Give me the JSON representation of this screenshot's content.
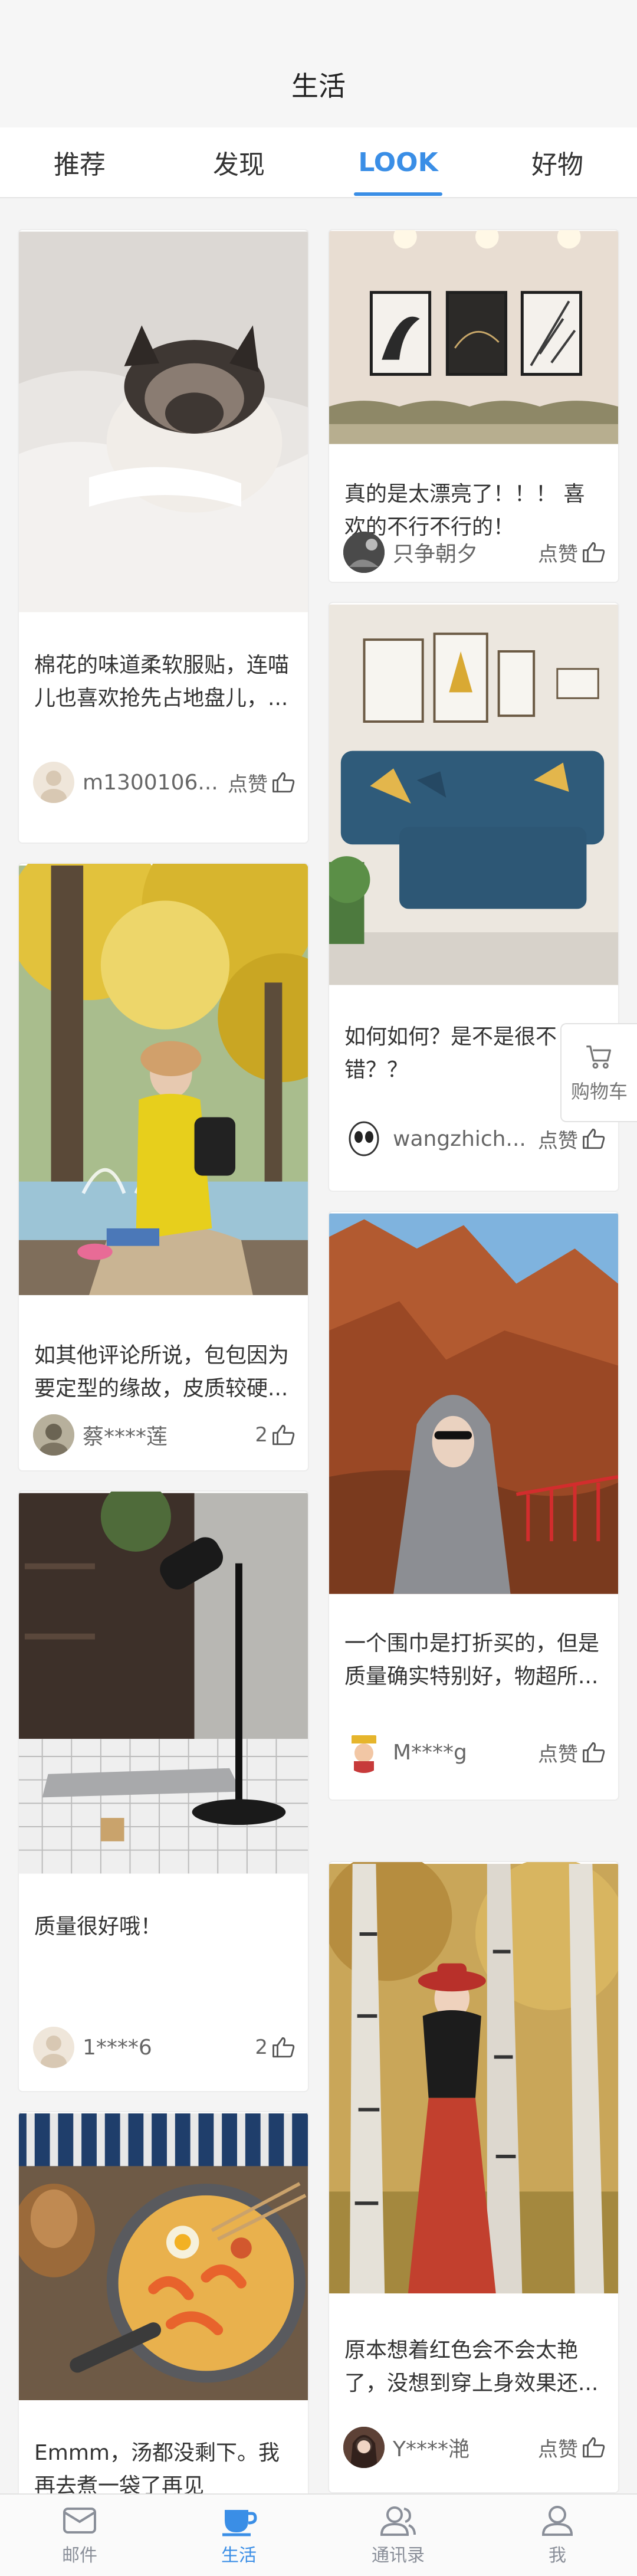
{
  "header": {
    "title": "生活"
  },
  "tabs": [
    {
      "label": "推荐",
      "active": false
    },
    {
      "label": "发现",
      "active": false
    },
    {
      "label": "LOOK",
      "active": true
    },
    {
      "label": "好物",
      "active": false
    }
  ],
  "posts": [
    {
      "column": "left",
      "photo": "cat-on-blanket",
      "text": "棉花的味道柔软服贴，连喵儿也喜欢抢先占地盘儿，...",
      "user": "m1300106...",
      "like": "点赞"
    },
    {
      "column": "right",
      "photo": "living-room-wall-art",
      "text": "真的是太漂亮了！！！ 喜欢的不行不行的！",
      "user": "只争朝夕",
      "like": "点赞"
    },
    {
      "column": "right",
      "photo": "blue-sofa-room",
      "text": "如何如何？是不是很不错？？",
      "user": "wangzhich...",
      "like": "点赞"
    },
    {
      "column": "left",
      "photo": "woman-yellow-coat-autumn",
      "text": "如其他评论所说，包包因为要定型的缘故，皮质较硬...",
      "user": "蔡****莲",
      "like": "2"
    },
    {
      "column": "right",
      "photo": "woman-grey-scarf-canyon",
      "text": "一个围巾是打折买的，但是质量确实特别好，物超所...",
      "user": "M****g",
      "like": "点赞"
    },
    {
      "column": "left",
      "photo": "floor-lamp-laptop",
      "text": "质量很好哦！",
      "user": "1****6",
      "like": "2"
    },
    {
      "column": "right",
      "photo": "woman-red-hat-birch-trees",
      "text": "原本想着红色会不会太艳了，没想到穿上身效果还...",
      "user": "Y****滟",
      "like": "点赞"
    },
    {
      "column": "left",
      "photo": "ramen-pot",
      "text": "Emmm，汤都没剩下。我再去煮一袋了再见",
      "user": "",
      "like": ""
    }
  ],
  "floating_cart": {
    "label": "购物车",
    "icon": "cart-icon"
  },
  "bottom_nav": [
    {
      "label": "邮件",
      "icon": "mail-icon",
      "active": false
    },
    {
      "label": "生活",
      "icon": "cup-icon",
      "active": true
    },
    {
      "label": "通讯录",
      "icon": "contacts-icon",
      "active": false
    },
    {
      "label": "我",
      "icon": "user-icon",
      "active": false
    }
  ],
  "colors": {
    "accent": "#3a8ee6",
    "background": "#f4f4f4"
  }
}
